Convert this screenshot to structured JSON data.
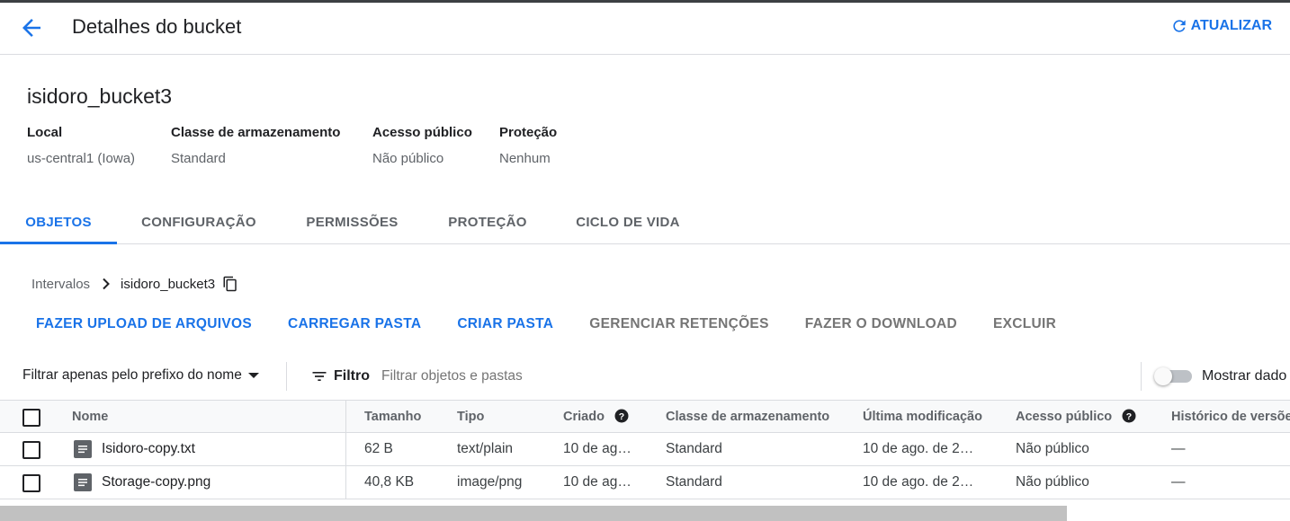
{
  "header": {
    "title": "Detalhes do bucket",
    "refresh_label": "ATUALIZAR"
  },
  "bucket": {
    "name": "isidoro_bucket3",
    "details": [
      {
        "label": "Local",
        "value": "us-central1 (Iowa)"
      },
      {
        "label": "Classe de armazenamento",
        "value": "Standard"
      },
      {
        "label": "Acesso público",
        "value": "Não público"
      },
      {
        "label": "Proteção",
        "value": "Nenhum"
      }
    ]
  },
  "tabs": [
    {
      "label": "OBJETOS",
      "active": true
    },
    {
      "label": "CONFIGURAÇÃO",
      "active": false
    },
    {
      "label": "PERMISSÕES",
      "active": false
    },
    {
      "label": "PROTEÇÃO",
      "active": false
    },
    {
      "label": "CICLO DE VIDA",
      "active": false
    }
  ],
  "breadcrumb": {
    "root": "Intervalos",
    "current": "isidoro_bucket3"
  },
  "actions": [
    {
      "label": "FAZER UPLOAD DE ARQUIVOS",
      "enabled": true
    },
    {
      "label": "CARREGAR PASTA",
      "enabled": true
    },
    {
      "label": "CRIAR PASTA",
      "enabled": true
    },
    {
      "label": "GERENCIAR RETENÇÕES",
      "enabled": false
    },
    {
      "label": "FAZER O DOWNLOAD",
      "enabled": false
    },
    {
      "label": "EXCLUIR",
      "enabled": false
    }
  ],
  "filter": {
    "prefix_label": "Filtrar apenas pelo prefixo do nome",
    "filter_label": "Filtro",
    "placeholder": "Filtrar objetos e pastas",
    "toggle_label": "Mostrar dado",
    "toggle_on": false
  },
  "table": {
    "columns": [
      "Nome",
      "Tamanho",
      "Tipo",
      "Criado",
      "Classe de armazenamento",
      "Última modificação",
      "Acesso público",
      "Histórico de versões"
    ],
    "rows": [
      {
        "name": "Isidoro-copy.txt",
        "size": "62 B",
        "type": "text/plain",
        "created": "10 de ag…",
        "storage_class": "Standard",
        "modified": "10 de ago. de 2…",
        "public_access": "Não público",
        "version_history": "—"
      },
      {
        "name": "Storage-copy.png",
        "size": "40,8 KB",
        "type": "image/png",
        "created": "10 de ag…",
        "storage_class": "Standard",
        "modified": "10 de ago. de 2…",
        "public_access": "Não público",
        "version_history": "—"
      }
    ]
  },
  "colors": {
    "accent": "#1a73e8",
    "disabled_action": "#757575",
    "border": "#dadce0"
  },
  "icons": [
    "arrow-back-icon",
    "refresh-icon",
    "chevron-right-icon",
    "copy-icon",
    "caret-down-icon",
    "filter-list-icon",
    "help-icon",
    "file-icon"
  ]
}
